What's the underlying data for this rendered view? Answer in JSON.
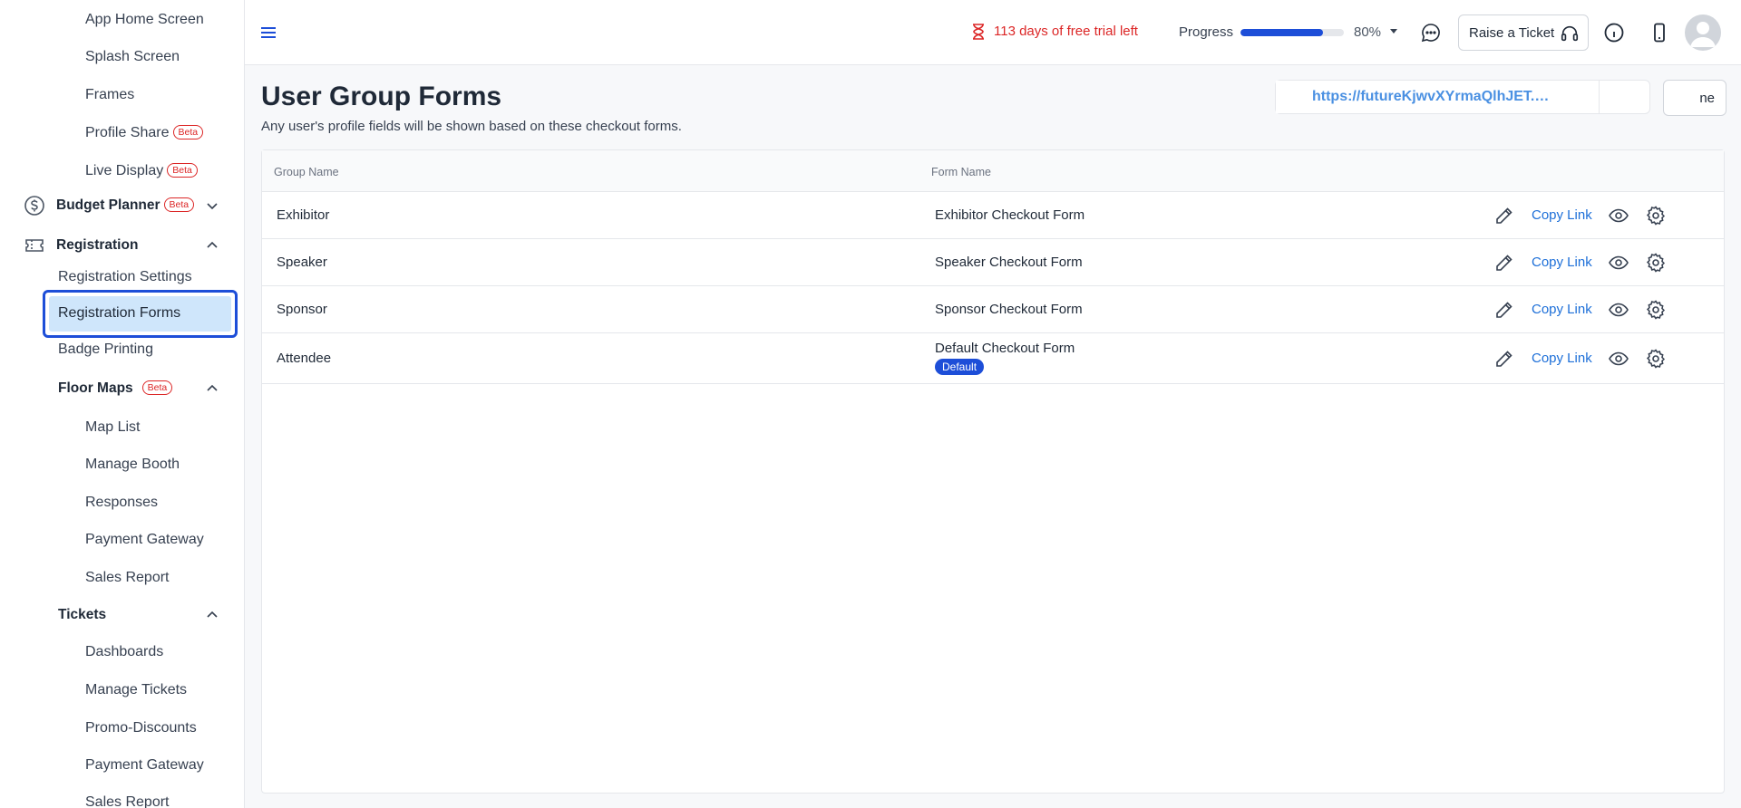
{
  "sidebar": {
    "items": [
      {
        "label": "App Home Screen"
      },
      {
        "label": "Splash Screen"
      },
      {
        "label": "Frames"
      },
      {
        "label": "Profile Share",
        "badge": "Beta"
      },
      {
        "label": "Live Display",
        "badge": "Beta"
      },
      {
        "label": "Budget Planner",
        "badge": "Beta"
      },
      {
        "label": "Registration"
      },
      {
        "label": "Registration Settings"
      },
      {
        "label": "Registration Forms"
      },
      {
        "label": "Badge Printing"
      },
      {
        "label": "Floor Maps",
        "badge": "Beta"
      },
      {
        "label": "Map List"
      },
      {
        "label": "Manage Booth"
      },
      {
        "label": "Responses"
      },
      {
        "label": "Payment Gateway"
      },
      {
        "label": "Sales Report"
      },
      {
        "label": "Tickets"
      },
      {
        "label": "Dashboards"
      },
      {
        "label": "Manage Tickets"
      },
      {
        "label": "Promo-Discounts"
      },
      {
        "label": "Payment Gateway"
      },
      {
        "label": "Sales Report"
      }
    ]
  },
  "header": {
    "trial_text": "113 days of free trial left",
    "progress_label": "Progress",
    "progress_value": 0.8,
    "progress_pct": "80%",
    "ticket_label": "Raise a Ticket",
    "accent": "#1d4ed8",
    "trial_color": "#dc2626"
  },
  "main": {
    "title": "User Group Forms",
    "subtitle": "Any user's profile fields will be shown based on these checkout forms.",
    "url_text": "https://futureKjwvXYrmaQlhJET.HOST...",
    "url_button": "ne",
    "table": {
      "columns": [
        "Group Name",
        "Form Name"
      ],
      "rows": [
        {
          "group": "Exhibitor",
          "form": "Exhibitor Checkout Form",
          "badge": "",
          "link": "Copy Link"
        },
        {
          "group": "Speaker",
          "form": "Speaker Checkout Form",
          "badge": "",
          "link": "Copy Link"
        },
        {
          "group": "Sponsor",
          "form": "Sponsor Checkout Form",
          "badge": "",
          "link": "Copy Link"
        },
        {
          "group": "Attendee",
          "form": "Default Checkout Form",
          "badge": "Default",
          "link": "Copy Link"
        }
      ]
    }
  }
}
